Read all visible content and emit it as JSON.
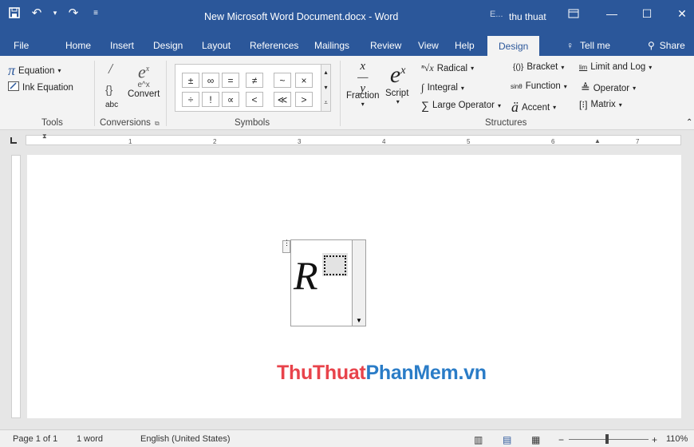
{
  "titlebar": {
    "doc_title": "New Microsoft Word Document.docx - Word",
    "user": "thu thuat",
    "user_badge": "E...",
    "qat_icons": [
      "save-icon",
      "undo-icon",
      "redo-icon",
      "customize-qat-icon"
    ]
  },
  "tabs": {
    "items": [
      "File",
      "Home",
      "Insert",
      "Design",
      "Layout",
      "References",
      "Mailings",
      "Review",
      "View",
      "Help"
    ],
    "active": "Design",
    "tell_me": "Tell me",
    "share": "Share"
  },
  "ribbon": {
    "tools": {
      "equation": "Equation",
      "ink_equation": "Ink Equation",
      "label": "Tools"
    },
    "conversions": {
      "convert": "Convert",
      "abc": "abc",
      "label": "Conversions"
    },
    "symbols": {
      "row1": [
        "±",
        "∞",
        "=",
        "≠",
        "~",
        "×"
      ],
      "row2": [
        "÷",
        "!",
        "∝",
        "<",
        "≪",
        ">"
      ],
      "label": "Symbols"
    },
    "structures": {
      "fraction": "Fraction",
      "script": "Script",
      "radical": "Radical",
      "integral": "Integral",
      "large_operator": "Large Operator",
      "bracket": "Bracket",
      "function": "Function",
      "accent": "Accent",
      "limit_and_log": "Limit and Log",
      "operator": "Operator",
      "matrix": "Matrix",
      "label": "Structures"
    }
  },
  "ruler": {
    "numbers": [
      "1",
      "2",
      "3",
      "4",
      "5",
      "6",
      "7"
    ]
  },
  "equation": {
    "base": "R"
  },
  "watermark": {
    "part1": "ThuThuat",
    "part2": "PhanMem",
    "part3": ".vn",
    "color_red": "#e8434b",
    "color_blue": "#2a7cc7"
  },
  "status": {
    "page": "Page 1 of 1",
    "words": "1 word",
    "language": "English (United States)",
    "zoom": "110%"
  },
  "colors": {
    "accent": "#2b579a"
  }
}
